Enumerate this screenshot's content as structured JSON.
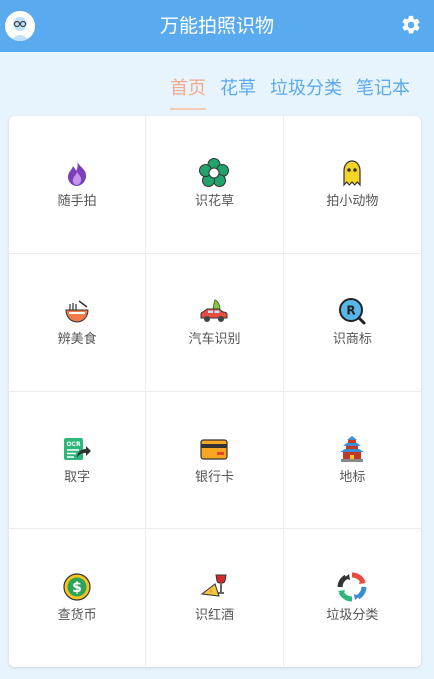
{
  "app": {
    "title": "万能拍照识物"
  },
  "tabs": [
    {
      "label": "首页",
      "active": true
    },
    {
      "label": "花草",
      "active": false
    },
    {
      "label": "垃圾分类",
      "active": false
    },
    {
      "label": "笔记本",
      "active": false
    }
  ],
  "features": [
    {
      "label": "随手拍",
      "icon": "purple-flame-icon"
    },
    {
      "label": "识花草",
      "icon": "green-flower-icon"
    },
    {
      "label": "拍小动物",
      "icon": "yellow-ghost-icon"
    },
    {
      "label": "辨美食",
      "icon": "noodle-bowl-icon"
    },
    {
      "label": "汽车识别",
      "icon": "car-icon"
    },
    {
      "label": "识商标",
      "icon": "registered-trademark-icon"
    },
    {
      "label": "取字",
      "icon": "ocr-icon"
    },
    {
      "label": "银行卡",
      "icon": "bank-card-icon"
    },
    {
      "label": "地标",
      "icon": "landmark-temple-icon"
    },
    {
      "label": "查货币",
      "icon": "dollar-coin-icon"
    },
    {
      "label": "识红酒",
      "icon": "red-wine-icon"
    },
    {
      "label": "垃圾分类",
      "icon": "recycle-icon"
    }
  ],
  "colors": {
    "primary": "#5aaaf0",
    "active_tab": "#f4a98c",
    "background": "#e8f4fd"
  }
}
